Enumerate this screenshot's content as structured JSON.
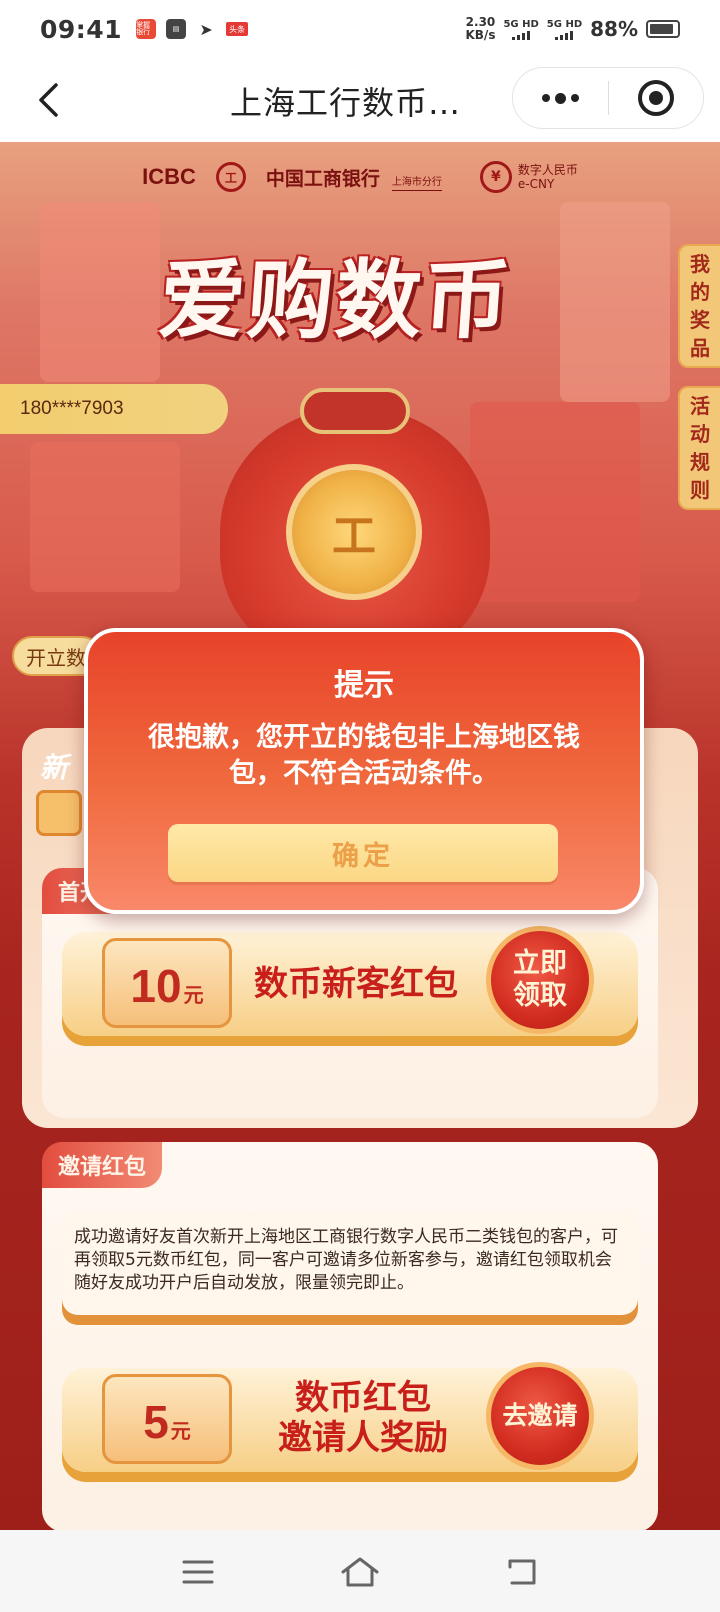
{
  "status_bar": {
    "time": "09:41",
    "app_badge_1": "掌握银行",
    "app_badge_2": "头条",
    "net_speed_value": "2.30",
    "net_speed_unit": "KB/s",
    "sim1_label": "5G HD",
    "sim2_label": "5G HD",
    "battery_percent": "88%"
  },
  "nav": {
    "title": "上海工行数币…"
  },
  "banner": {
    "brand_en": "ICBC",
    "brand_logo_glyph": "工",
    "brand_cn": "中国工商银行",
    "brand_branch": "上海市分行",
    "ecny_glyph": "¥",
    "ecny_cn": "数字人民币",
    "ecny_en": "e-CNY",
    "hero_title": "爱购数币",
    "phone": "180****7903",
    "coin_glyph": "工",
    "side_tabs": [
      {
        "label": "我的奖品",
        "chars": [
          "我",
          "的",
          "奖",
          "品"
        ]
      },
      {
        "label": "活动规则",
        "chars": [
          "活",
          "动",
          "规",
          "则"
        ]
      }
    ],
    "open_tab_label": "开立数"
  },
  "section_new": {
    "header_partial": "新",
    "tag": "首开红包",
    "coupon_amount": "10",
    "coupon_unit": "元",
    "coupon_title": "数币新客红包",
    "claim_button": "立即领取"
  },
  "section_invite": {
    "tag": "邀请红包",
    "description": "成功邀请好友首次新开上海地区工商银行数字人民币二类钱包的客户，可再领取5元数币红包，同一客户可邀请多位新客参与，邀请红包领取机会随好友成功开户后自动发放，限量领完即止。",
    "coupon_amount": "5",
    "coupon_unit": "元",
    "coupon_title_line1": "数币红包",
    "coupon_title_line2": "邀请人奖励",
    "invite_button": "去邀请"
  },
  "dialog": {
    "title": "提示",
    "message": "很抱歉，您开立的钱包非上海地区钱包，不符合活动条件。",
    "confirm": "确定"
  },
  "colors": {
    "dialog_top": "#e8432a",
    "dialog_bottom": "#f9886a",
    "confirm_bg": "#fbd785",
    "confirm_text": "#eca04a",
    "brand_red": "#a01818"
  },
  "icons": {
    "back": "chevron-left-icon",
    "more": "more-dots-icon",
    "close": "target-close-icon",
    "menu": "menu-icon",
    "home": "home-icon",
    "back_nav": "return-icon"
  }
}
